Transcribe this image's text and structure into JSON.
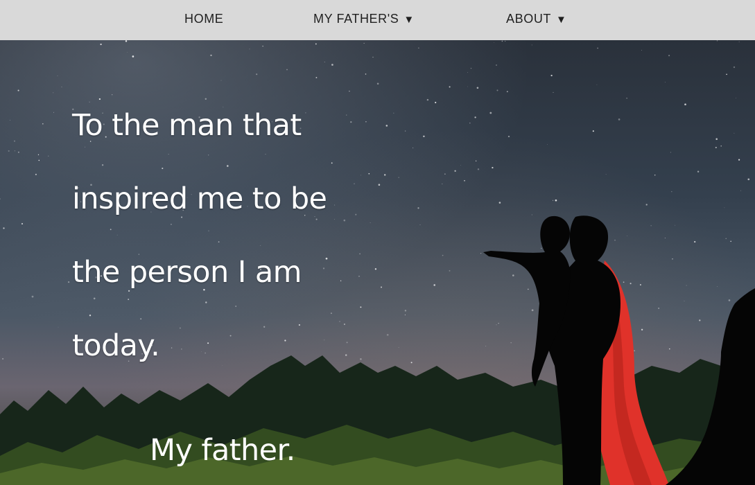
{
  "nav": {
    "home_label": "HOME",
    "fathers_label": "MY FATHER'S",
    "about_label": "ABOUT",
    "dropdown_glyph": "▼"
  },
  "hero": {
    "quote_lines": [
      "To the man that",
      "inspired me to be",
      "the person I am",
      "today."
    ],
    "signature": "My father.",
    "image_description_icon": "father-son-silhouette-icon"
  },
  "colors": {
    "nav_bg": "#d9d9d9",
    "nav_text": "#1f1f1f",
    "text": "#ffffff",
    "cape": "#e0322a"
  }
}
